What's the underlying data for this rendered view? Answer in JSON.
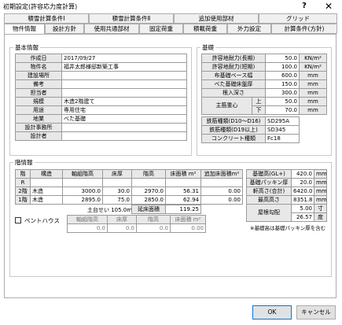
{
  "window": {
    "title": "初期設定(許容応力度計算)",
    "help": "?",
    "close": "✕"
  },
  "tabs_back": [
    "積雪計算条件Ⅰ",
    "積雪計算条件Ⅱ",
    "追加使用部材",
    "グリッド"
  ],
  "tabs_front": [
    "物件情報",
    "設計方針",
    "使用共通部材",
    "固定荷重",
    "積載荷重",
    "外力設定",
    "計算条件(方針)"
  ],
  "basic": {
    "title": "基本情報",
    "rows": [
      {
        "label": "作成日",
        "value": "2017/09/27"
      },
      {
        "label": "物件名",
        "value": "福井太郎様邸新築工事"
      },
      {
        "label": "建設場所",
        "value": ""
      },
      {
        "label": "備考",
        "value": ""
      },
      {
        "label": "担当者",
        "value": ""
      },
      {
        "label": "規模",
        "value": "木造2階建て"
      },
      {
        "label": "用途",
        "value": "専用住宅"
      },
      {
        "label": "地業",
        "value": "べた基礎"
      },
      {
        "label": "設計事務所",
        "value": ""
      },
      {
        "label": "設計者",
        "value": ""
      }
    ]
  },
  "foundation": {
    "title": "基礎",
    "rows": [
      {
        "label": "許容地耐力(長期)",
        "value": "50.0",
        "unit": "KN/m²"
      },
      {
        "label": "許容地耐力(短期)",
        "value": "100.0",
        "unit": "KN/m²"
      },
      {
        "label": "布基礎ベース幅",
        "value": "600.0",
        "unit": "mm"
      },
      {
        "label": "べた基礎床盤厚",
        "value": "150.0",
        "unit": "mm"
      },
      {
        "label": "根入深さ",
        "value": "300.0",
        "unit": "mm"
      }
    ],
    "eccentric": {
      "label": "主筋重心",
      "upper_label": "上",
      "upper_value": "50.0",
      "lower_label": "下",
      "lower_value": "70.0",
      "unit": "mm"
    },
    "rebar_rows": [
      {
        "label": "鉄筋種類(D10〜D16)",
        "value": "SD295A"
      },
      {
        "label": "鉄筋種類(D19以上)",
        "value": "SD345"
      },
      {
        "label": "コンクリート種類",
        "value": "Fc18"
      }
    ]
  },
  "floors": {
    "title": "階情報",
    "headers": [
      "階",
      "構造",
      "軸組階高",
      "床厚",
      "階高",
      "床面積 m²",
      "追加床面積m²"
    ],
    "rows": [
      {
        "floor": "R",
        "structure": "",
        "axial": "",
        "slab": "",
        "height": "",
        "area": "",
        "extra": ""
      },
      {
        "floor": "2階",
        "structure": "木造",
        "axial": "3000.0",
        "slab": "30.0",
        "height": "2970.0",
        "area": "56.31",
        "extra": "0.00"
      },
      {
        "floor": "1階",
        "structure": "木造",
        "axial": "2895.0",
        "slab": "75.0",
        "height": "2850.0",
        "area": "62.94",
        "extra": "0.00"
      }
    ],
    "dodai_label": "土台せい 105.0mm",
    "total_label": "延床面積",
    "total_value": "119.25",
    "penthouse": {
      "label": "ペントハウス",
      "headers": [
        "軸組階高",
        "床厚",
        "階高",
        "床面積 m²"
      ],
      "values": [
        "0.0",
        "0.0",
        "0.0",
        "0.00"
      ]
    },
    "side": [
      {
        "label": "基礎高(GL+)",
        "value": "420.0",
        "unit": "mm"
      },
      {
        "label": "基礎パッキン厚",
        "value": "20.0",
        "unit": "mm"
      },
      {
        "label": "軒高さ(合計)",
        "value": "6420.0",
        "unit": "mm"
      },
      {
        "label": "最高高さ",
        "value": "8351.8",
        "unit": "mm"
      }
    ],
    "roof": {
      "label": "屋根勾配",
      "value1": "5.00",
      "unit1": "寸",
      "value2": "26.57",
      "unit2": "度"
    },
    "note": "※基礎高は基礎パッキン厚を含む"
  },
  "buttons": {
    "ok": "OK",
    "cancel": "キャンセル"
  }
}
